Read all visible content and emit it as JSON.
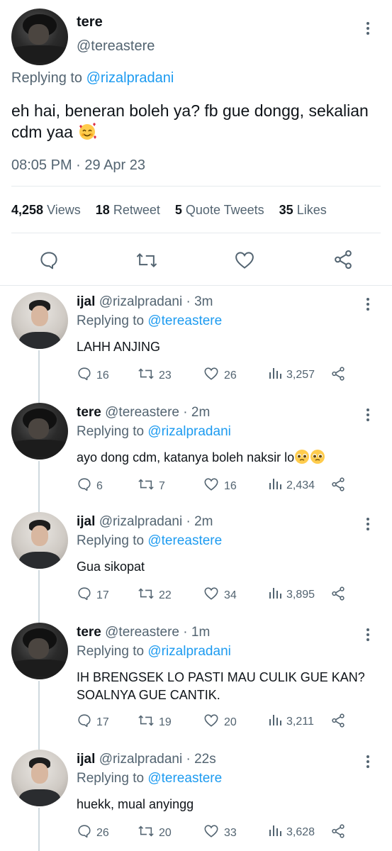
{
  "main_tweet": {
    "name": "tere",
    "handle": "@tereastere",
    "replying_prefix": "Replying to",
    "replying_to": "@rizalpradani",
    "text": "eh hai, beneran boleh ya? fb gue dongg, sekalian cdm yaa",
    "emoji": "smiling-face-with-hearts",
    "time": "08:05 PM · 29 Apr 23",
    "stats": {
      "views_count": "4,258",
      "views_label": "Views",
      "retweet_count": "18",
      "retweet_label": "Retweet",
      "quote_count": "5",
      "quote_label": "Quote Tweets",
      "likes_count": "35",
      "likes_label": "Likes"
    }
  },
  "replies": [
    {
      "name": "ijal",
      "handle": "@rizalpradani",
      "time": "· 3m",
      "replying_prefix": "Replying to",
      "replying_to": "@tereastere",
      "text": "LAHH ANJING",
      "replies": "16",
      "retweets": "23",
      "likes": "26",
      "views": "3,257",
      "avatar": "ijal"
    },
    {
      "name": "tere",
      "handle": "@tereastere",
      "time": "· 2m",
      "replying_prefix": "Replying to",
      "replying_to": "@rizalpradani",
      "text": "ayo dong cdm, katanya boleh naksir lo",
      "emoji": "pleading-face-x2",
      "replies": "6",
      "retweets": "7",
      "likes": "16",
      "views": "2,434",
      "avatar": "tere"
    },
    {
      "name": "ijal",
      "handle": "@rizalpradani",
      "time": "· 2m",
      "replying_prefix": "Replying to",
      "replying_to": "@tereastere",
      "text": "Gua sikopat",
      "replies": "17",
      "retweets": "22",
      "likes": "34",
      "views": "3,895",
      "avatar": "ijal"
    },
    {
      "name": "tere",
      "handle": "@tereastere",
      "time": "· 1m",
      "replying_prefix": "Replying to",
      "replying_to": "@rizalpradani",
      "text": "IH BRENGSEK LO PASTI MAU CULIK GUE KAN? SOALNYA GUE CANTIK.",
      "replies": "17",
      "retweets": "19",
      "likes": "20",
      "views": "3,211",
      "avatar": "tere"
    },
    {
      "name": "ijal",
      "handle": "@rizalpradani",
      "time": "· 22s",
      "replying_prefix": "Replying to",
      "replying_to": "@tereastere",
      "text": "huekk, mual anyingg",
      "replies": "26",
      "retweets": "20",
      "likes": "33",
      "views": "3,628",
      "avatar": "ijal"
    }
  ],
  "colors": {
    "link": "#1d9bf0",
    "secondary": "#536471",
    "text": "#0f1419",
    "divider": "#e6eaed"
  }
}
